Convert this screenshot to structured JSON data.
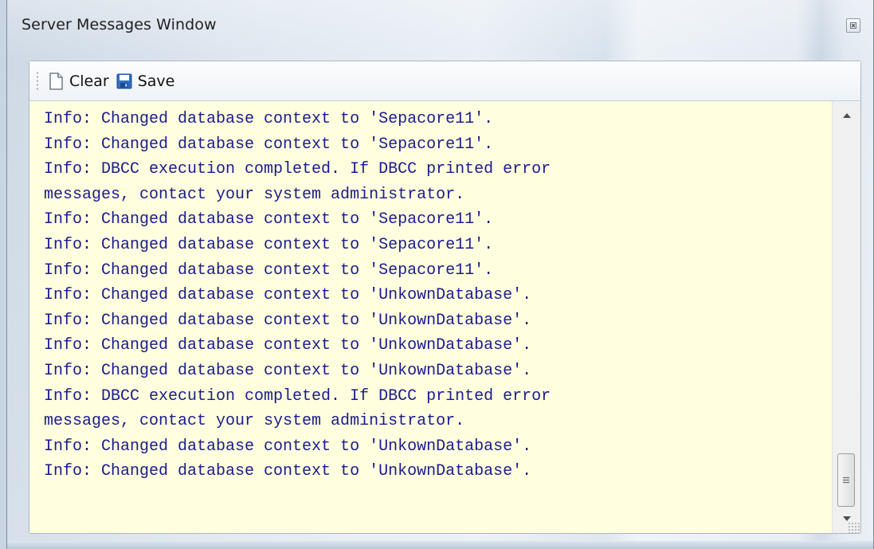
{
  "window": {
    "title": "Server Messages Window"
  },
  "toolbar": {
    "clear_label": "Clear",
    "save_label": "Save"
  },
  "messages": [
    "Info: Changed database context to 'Sepacore11'.",
    "Info: Changed database context to 'Sepacore11'.",
    "Info: DBCC execution completed. If DBCC printed error",
    "messages, contact your system administrator.",
    "Info: Changed database context to 'Sepacore11'.",
    "Info: Changed database context to 'Sepacore11'.",
    "Info: Changed database context to 'Sepacore11'.",
    "Info: Changed database context to 'UnkownDatabase'.",
    "Info: Changed database context to 'UnkownDatabase'.",
    "Info: Changed database context to 'UnkownDatabase'.",
    "Info: Changed database context to 'UnkownDatabase'.",
    "Info: DBCC execution completed. If DBCC printed error",
    "messages, contact your system administrator.",
    "Info: Changed database context to 'UnkownDatabase'.",
    "Info: Changed database context to 'UnkownDatabase'."
  ],
  "icons": {
    "close": "close-icon",
    "clear": "new-document-icon",
    "save": "floppy-disk-icon",
    "scroll_up": "chevron-up-icon",
    "scroll_down": "chevron-down-icon",
    "scroll_thumb": "grip-lines-icon"
  },
  "colors": {
    "message_text": "#1b1b8f",
    "message_background": "#ffffdf"
  }
}
